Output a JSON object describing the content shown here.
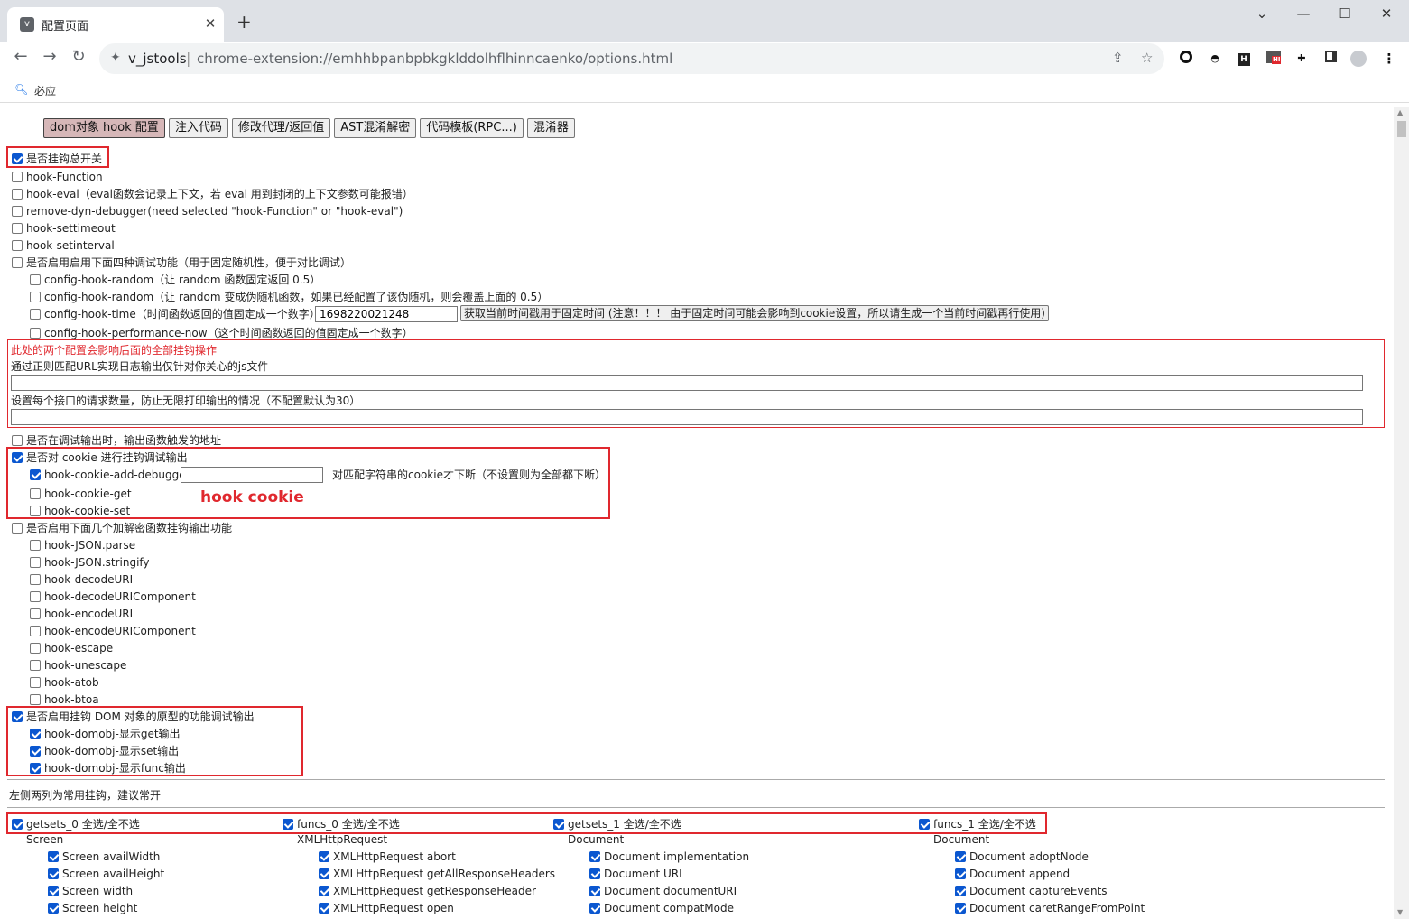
{
  "browser": {
    "tab_favicon": "v",
    "tab_title": "配置页面",
    "close_glyph": "✕",
    "new_tab_glyph": "+",
    "win_min": "⌄",
    "win_minimize": "—",
    "win_max": "☐",
    "win_close": "✕",
    "back_glyph": "←",
    "forward_glyph": "→",
    "reload_glyph": "↻",
    "site_icon": "puzzle-icon",
    "site_name": "v_jstools",
    "separator": "|",
    "url": "chrome-extension://emhhbpanbpbkgklddolhflhinncaenko/options.html",
    "share_glyph": "⇪",
    "star_glyph": "☆",
    "ext_badge": "HI",
    "menu_glyph": "⋮"
  },
  "bookmarks": {
    "icon": "search-icon",
    "item": "必应"
  },
  "tabs": [
    "dom对象 hook 配置",
    "注入代码",
    "修改代理/返回值",
    "AST混淆解密",
    "代码模板(RPC...)",
    "混淆器"
  ],
  "main": {
    "master_switch": "是否挂钩总开关",
    "hook_function": "hook-Function",
    "hook_eval": "hook-eval（eval函数会记录上下文，若 eval 用到封闭的上下文参数可能报错）",
    "remove_debugger": "remove-dyn-debugger(need selected \"hook-Function\" or \"hook-eval\")",
    "hook_settimeout": "hook-settimeout",
    "hook_setinterval": "hook-setinterval",
    "random_group": "是否启用启用下面四种调试功能（用于固定随机性，便于对比调试）",
    "random_1": "config-hook-random（让 random 函数固定返回 0.5）",
    "random_2": "config-hook-random（让 random 变成伪随机函数，如果已经配置了该伪随机，则会覆盖上面的 0.5）",
    "hook_time": "config-hook-time（时间函数返回的值固定成一个数字）",
    "time_value": "1698220021248",
    "time_button": "获取当前时间戳用于固定时间 (注意！！！ 由于固定时间可能会影响到cookie设置，所以请生成一个当前时间戳再行使用)",
    "perf_now": "config-hook-performance-now（这个时间函数返回的值固定成一个数字）",
    "warning": "此处的两个配置会影响后面的全部挂钩操作",
    "url_regex_label": "通过正则匹配URL实现日志输出仅针对你关心的js文件",
    "request_limit_label": "设置每个接口的请求数量，防止无限打印输出的情况（不配置默认为30）",
    "print_caller": "是否在调试输出时，输出函数触发的地址",
    "cookie_group": "是否对 cookie 进行挂钩调试输出",
    "cookie_debugger": "hook-cookie-add-debugger",
    "cookie_debugger_hint": "对匹配字符串的cookie才下断（不设置则为全部都下断）",
    "cookie_get": "hook-cookie-get",
    "cookie_set": "hook-cookie-set",
    "annotation": "hook cookie",
    "crypto_group": "是否启用下面几个加解密函数挂钩输出功能",
    "crypto_items": [
      "hook-JSON.parse",
      "hook-JSON.stringify",
      "hook-decodeURI",
      "hook-decodeURIComponent",
      "hook-encodeURI",
      "hook-encodeURIComponent",
      "hook-escape",
      "hook-unescape",
      "hook-atob",
      "hook-btoa"
    ],
    "dom_group": "是否启用挂钩 DOM 对象的原型的功能调试输出",
    "dom_items": [
      "hook-domobj-显示get输出",
      "hook-domobj-显示set输出",
      "hook-domobj-显示func输出"
    ],
    "tip": "左侧两列为常用挂钩，建议常开"
  },
  "columns": [
    {
      "toggle": "getsets_0 全选/全不选",
      "group": "Screen",
      "items": [
        "Screen availWidth",
        "Screen availHeight",
        "Screen width",
        "Screen height"
      ]
    },
    {
      "toggle": "funcs_0 全选/全不选",
      "group": "XMLHttpRequest",
      "items": [
        "XMLHttpRequest abort",
        "XMLHttpRequest getAllResponseHeaders",
        "XMLHttpRequest getResponseHeader",
        "XMLHttpRequest open"
      ]
    },
    {
      "toggle": "getsets_1 全选/全不选",
      "group": "Document",
      "items": [
        "Document implementation",
        "Document URL",
        "Document documentURI",
        "Document compatMode"
      ]
    },
    {
      "toggle": "funcs_1 全选/全不选",
      "group": "Document",
      "items": [
        "Document adoptNode",
        "Document append",
        "Document captureEvents",
        "Document caretRangeFromPoint"
      ]
    }
  ],
  "colors": {
    "accent": "#0b57d0",
    "annotation_red": "#e0282e",
    "active_tab": "#d6b7b8"
  }
}
